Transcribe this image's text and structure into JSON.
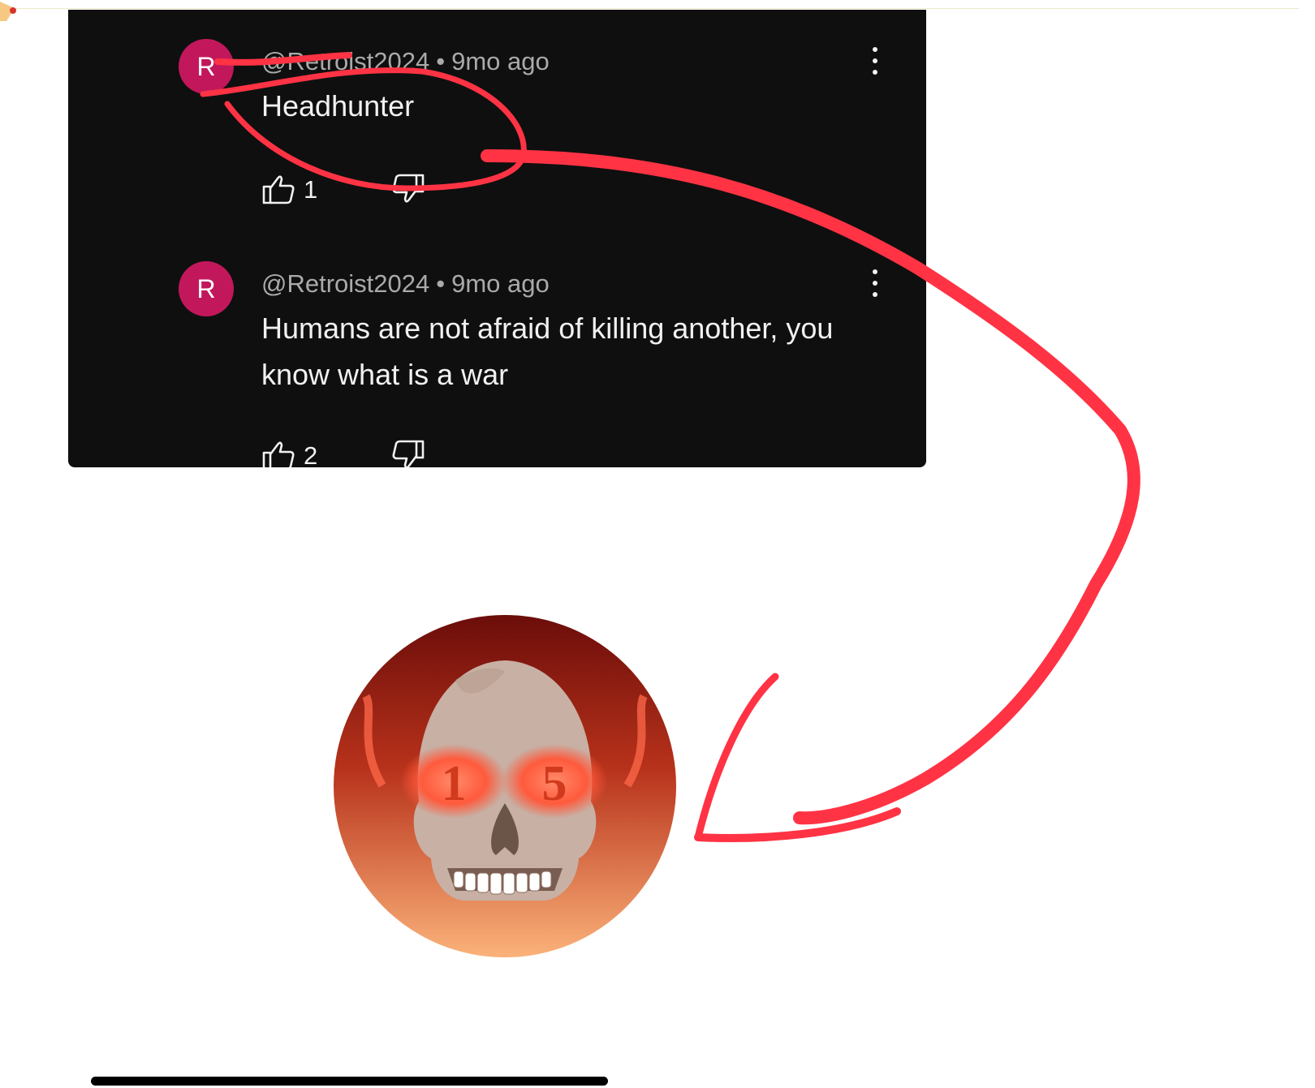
{
  "comments": [
    {
      "avatar_letter": "R",
      "handle": "@Retroist2024",
      "separator": "•",
      "time": "9mo ago",
      "text": "Headhunter",
      "likes": "1",
      "like_icon": "thumbs-up-icon",
      "dislike_icon": "thumbs-down-icon",
      "menu_icon": "kebab-menu-icon"
    },
    {
      "avatar_letter": "R",
      "handle": "@Retroist2024",
      "separator": "•",
      "time": "9mo ago",
      "text": "Humans are not afraid of killing another, you know what is a war",
      "likes": "2",
      "like_icon": "thumbs-up-icon",
      "dislike_icon": "thumbs-down-icon",
      "menu_icon": "kebab-menu-icon"
    }
  ],
  "profile_picture": {
    "eye_left": "1",
    "eye_right": "5",
    "subject": "skull with glowing eyes"
  },
  "colors": {
    "panel_bg": "#0f0f0f",
    "avatar_bg": "#c2185b",
    "annotation_red": "#ff3344",
    "meta_text": "#aaaaaa",
    "body_text": "#f1f1f1"
  }
}
